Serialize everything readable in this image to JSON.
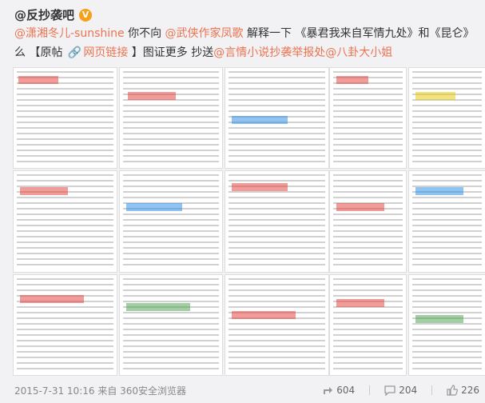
{
  "post": {
    "author": "@反抄袭吧",
    "badge": "V",
    "mention_1": "@潇湘冬儿-sunshine",
    "text_1": " 你不向 ",
    "mention_2": "@武侠作家凤歌",
    "text_2": " 解释一下 《暴君我来自军情九处》和《昆仑》",
    "text_3": "么 【原帖 ",
    "link_label": "网页链接",
    "text_4": " 】图证更多 抄送",
    "mention_3": "@言情小说抄袭举报处",
    "mention_4": "@八卦大小姐"
  },
  "images": [
    {
      "name": "image-1",
      "accent": "#e53935"
    },
    {
      "name": "image-2",
      "accent": "#e53935"
    },
    {
      "name": "image-3",
      "accent": "#1e88e5"
    },
    {
      "name": "image-4",
      "accent": "#e53935"
    },
    {
      "name": "image-5",
      "accent": "#1e88e5"
    },
    {
      "name": "image-6",
      "accent": "#e53935"
    },
    {
      "name": "image-7",
      "accent": "#e53935"
    },
    {
      "name": "image-8",
      "accent": "#43a047"
    },
    {
      "name": "image-9",
      "accent": "#e53935"
    }
  ],
  "footer": {
    "timestamp": "2015-7-31 10:16 来自 360安全浏览器",
    "shares": "604",
    "comments": "204",
    "likes": "226"
  },
  "colors": {
    "link": "#eb7350",
    "text": "#333333",
    "meta": "#888888"
  }
}
